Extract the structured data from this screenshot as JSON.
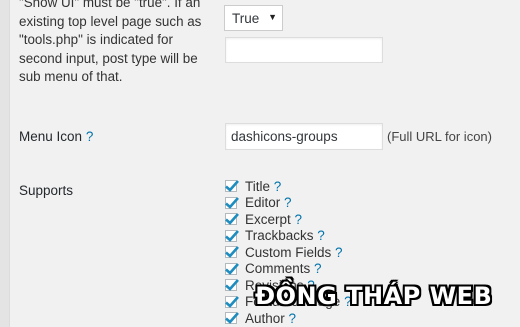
{
  "description_text": "\"Show UI\" must be \"true\". If an existing top level page such as \"tools.php\" is indicated for second input, post type will be sub menu of that.",
  "show_in_menu": {
    "selected": "True",
    "second_input_value": ""
  },
  "menu_icon": {
    "label": "Menu Icon",
    "help": "?",
    "value": "dashicons-groups",
    "hint": "(Full URL for icon)"
  },
  "supports": {
    "label": "Supports",
    "items": [
      {
        "label": "Title",
        "help": "?",
        "checked": true
      },
      {
        "label": "Editor",
        "help": "?",
        "checked": true
      },
      {
        "label": "Excerpt",
        "help": "?",
        "checked": true
      },
      {
        "label": "Trackbacks",
        "help": "?",
        "checked": true
      },
      {
        "label": "Custom Fields",
        "help": "?",
        "checked": true
      },
      {
        "label": "Comments",
        "help": "?",
        "checked": true
      },
      {
        "label": "Revisions",
        "help": "?",
        "checked": true
      },
      {
        "label": "Featured Image",
        "help": "?",
        "checked": true
      },
      {
        "label": "Author",
        "help": "?",
        "checked": true
      }
    ]
  },
  "watermark_text": "ĐỒNG THÁP WEB",
  "colors": {
    "link": "#0073aa",
    "checkmark": "#1e8cbe",
    "background": "#f1f1f1"
  }
}
